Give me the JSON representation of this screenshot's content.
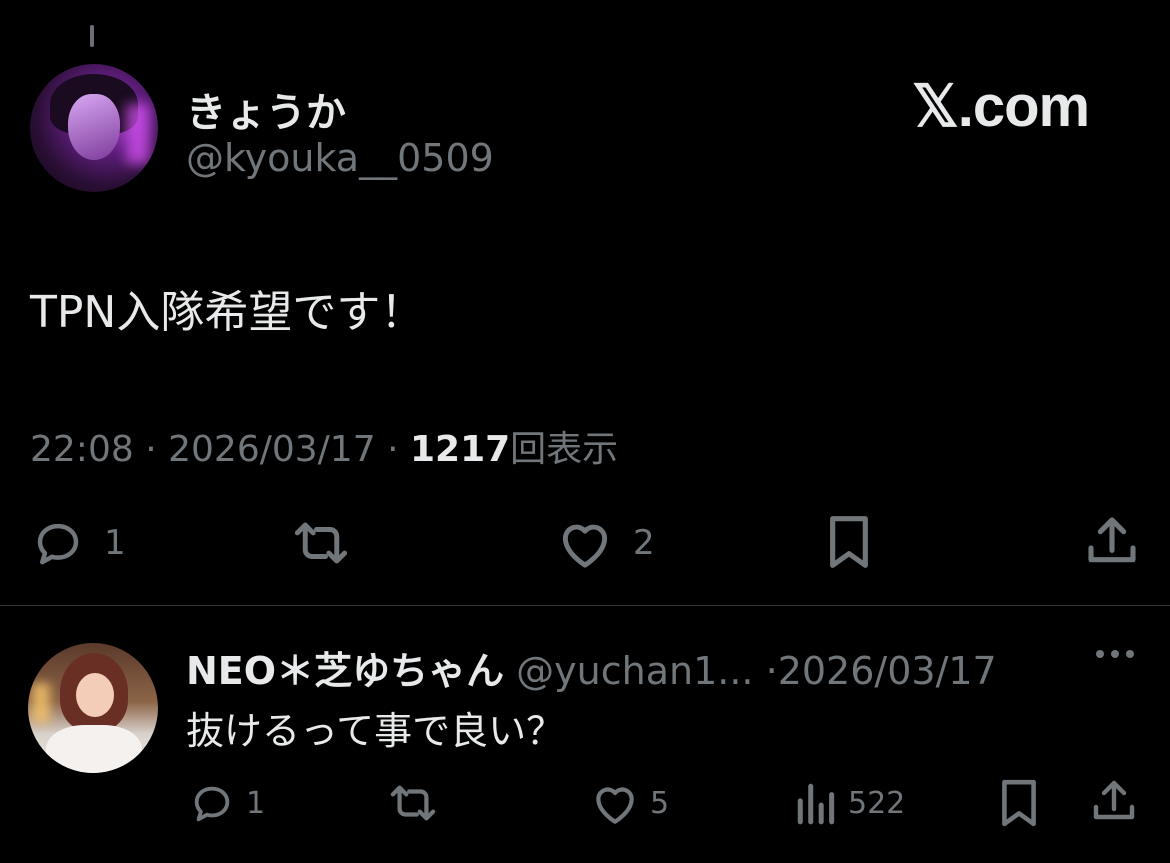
{
  "tweet": {
    "display_name": "きょうか",
    "handle": "@kyouka__0509",
    "brand": "𝕏.com",
    "text": "TPN入隊希望です！",
    "time": "22:08",
    "sep1": "·",
    "date": "2026/03/17",
    "sep2": "·",
    "views": "1217",
    "views_label": "回表示",
    "actions": {
      "reply_count": "1",
      "retweet_count": "",
      "like_count": "2"
    }
  },
  "reply": {
    "display_name": "NEO＊芝ゆちゃん",
    "handle": "@yuchan1...",
    "sep": "·",
    "date": "2026/03/17",
    "text": "抜けるって事で良い？",
    "actions": {
      "reply_count": "1",
      "retweet_count": "",
      "like_count": "5",
      "views_count": "522"
    }
  },
  "colors": {
    "background": "#000000",
    "text_primary": "#e7e9ea",
    "text_secondary": "#71767b",
    "divider": "#2f3336"
  },
  "icons": [
    "reply-icon",
    "retweet-icon",
    "like-icon",
    "bookmark-icon",
    "share-icon",
    "views-icon",
    "more-icon"
  ]
}
